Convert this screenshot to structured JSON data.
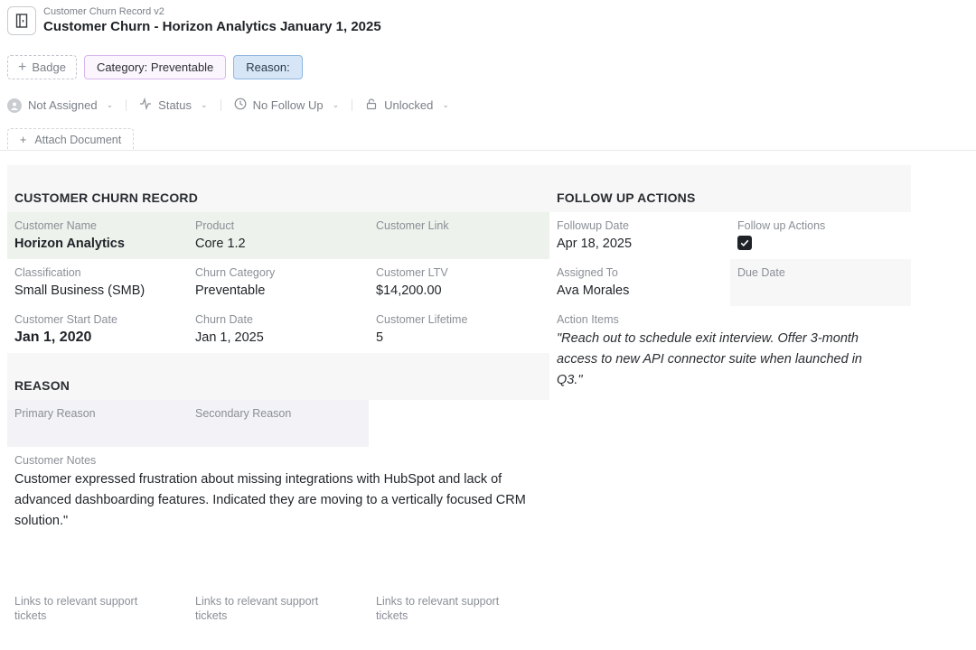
{
  "header": {
    "subtitle": "Customer Churn Record v2",
    "title": "Customer Churn - Horizon Analytics January 1, 2025"
  },
  "badges": {
    "add_label": "Badge",
    "category": "Category: Preventable",
    "reason": "Reason:"
  },
  "properties": {
    "assignee": "Not Assigned",
    "status": "Status",
    "follow_up": "No Follow Up",
    "lock": "Unlocked"
  },
  "attach_label": "Attach Document",
  "churn_record": {
    "title": "CUSTOMER CHURN RECORD",
    "customer_name_label": "Customer Name",
    "customer_name": "Horizon Analytics",
    "product_label": "Product",
    "product": "Core 1.2",
    "customer_link_label": "Customer Link",
    "classification_label": "Classification",
    "classification": "Small Business (SMB)",
    "churn_category_label": "Churn Category",
    "churn_category": "Preventable",
    "ltv_label": "Customer LTV",
    "ltv": "$14,200.00",
    "start_date_label": "Customer Start Date",
    "start_date": "Jan 1, 2020",
    "churn_date_label": "Churn Date",
    "churn_date": "Jan 1, 2025",
    "lifetime_label": "Customer Lifetime",
    "lifetime": "5"
  },
  "reason": {
    "title": "REASON",
    "primary_label": "Primary Reason",
    "secondary_label": "Secondary Reason",
    "notes_label": "Customer Notes",
    "notes": "Customer expressed frustration about missing integrations with HubSpot and lack of advanced dashboarding features. Indicated they are moving to a vertically focused CRM solution.\"",
    "links": [
      "Links to relevant support tickets",
      "Links to relevant support tickets",
      "Links to relevant support tickets"
    ]
  },
  "follow_up": {
    "title": "FOLLOW UP ACTIONS",
    "date_label": "Followup Date",
    "date": "Apr 18, 2025",
    "actions_label": "Follow up Actions",
    "actions_checked": true,
    "assigned_label": "Assigned To",
    "assigned": "Ava Morales",
    "due_label": "Due Date",
    "items_label": "Action Items",
    "items": "\"Reach out to schedule exit interview. Offer 3-month access to new API connector suite when launched in Q3.\""
  },
  "colors": {
    "highlight_green": "#edf2ec",
    "section_gray": "#f7f7f8",
    "reason_gray": "#f3f2f6",
    "category_border": "#d9b6ee",
    "reason_badge_bg": "#d6e6f7"
  }
}
